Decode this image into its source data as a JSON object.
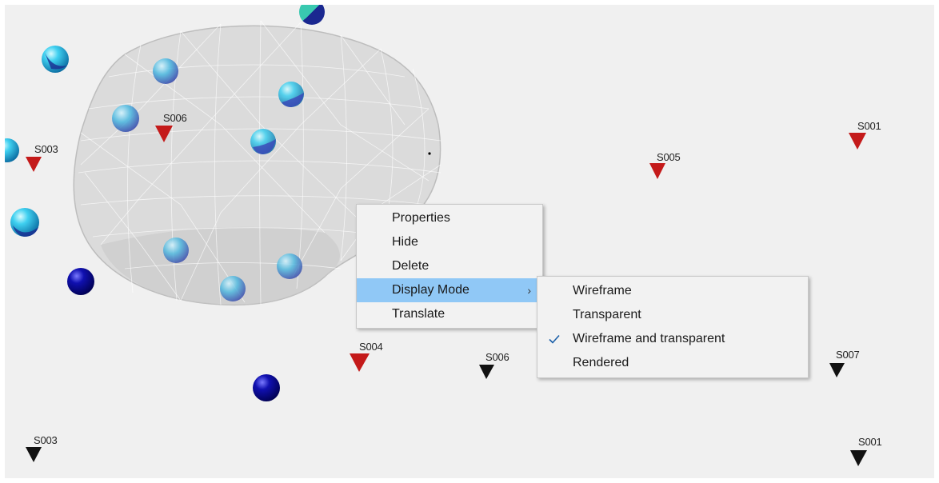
{
  "viewport": {
    "background": "#f0f0f0",
    "stations_red": [
      {
        "label": "S006"
      },
      {
        "label": "S003"
      },
      {
        "label": "S005"
      },
      {
        "label": "S001"
      },
      {
        "label": "S004"
      }
    ],
    "stations_black": [
      {
        "label": "S006"
      },
      {
        "label": "S007"
      },
      {
        "label": "S003"
      },
      {
        "label": "S001"
      }
    ]
  },
  "context_menu": {
    "items": [
      {
        "label": "Properties"
      },
      {
        "label": "Hide"
      },
      {
        "label": "Delete"
      },
      {
        "label": "Display Mode",
        "arrow": "›"
      },
      {
        "label": "Translate"
      }
    ]
  },
  "submenu": {
    "items": [
      {
        "label": "Wireframe"
      },
      {
        "label": "Transparent"
      },
      {
        "label": "Wireframe and transparent",
        "checked": true,
        "check_icon": "✓"
      },
      {
        "label": "Rendered"
      }
    ]
  },
  "colors": {
    "red_station": "#c41a1a",
    "black_station": "#111111",
    "menu_highlight": "#90c8f6",
    "checked_bg": "#cce4f7"
  }
}
